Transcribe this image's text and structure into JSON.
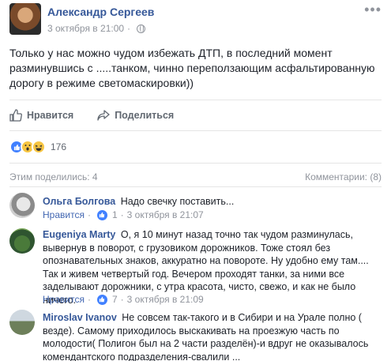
{
  "post": {
    "author": "Александр Сергеев",
    "timestamp": "3 октября в 21:00",
    "separator": "·",
    "text": "Только у нас можно чудом избежать ДТП, в последний момент разминувшись с .....танком, чинно переползающим асфальтированную дорогу в режиме светомаскировки))",
    "menu": "•••"
  },
  "actions": {
    "like_label": "Нравится",
    "share_label": "Поделиться"
  },
  "reactions": {
    "count": "176",
    "types": [
      "like-icon",
      "wow-icon",
      "haha-icon"
    ]
  },
  "stats": {
    "shares": "Этим поделились: 4",
    "comments": "Комментарии: (8)"
  },
  "comments": [
    {
      "author": "Ольга Болгова",
      "text": "Надо свечку поставить...",
      "like_label": "Нравится",
      "likes": "1",
      "timestamp": "3 октября в 21:07"
    },
    {
      "author": "Eugeniya Marty",
      "text": "О, я 10 минут назад точно так чудом разминулась, вывернув в поворот, с грузовиком дорожников. Тоже стоял без опознавательных знаков, аккуратно на повороте. Ну удобно ему там.... Так и живем четвертый год. Вечером проходят танки, за ними все заделывают дорожники, с утра красота, чисто, свежо, и как не было ничего.",
      "like_label": "Нравится",
      "likes": "7",
      "timestamp": "3 октября в 21:09"
    },
    {
      "author": "Miroslav Ivanov",
      "text": "Не совсем так-такого и в Сибири и на Урале полно ( везде). Самому приходилось выскакивать на проезжую часть по молодости( Полигон был на 2 части разделён)-и вдруг не оказывалось комендантского подразделения-свалили ...",
      "like_label": "",
      "likes": "",
      "timestamp": ""
    }
  ],
  "colors": {
    "link": "#365899",
    "meta": "#90949c",
    "like_blue": "#4080ff"
  }
}
